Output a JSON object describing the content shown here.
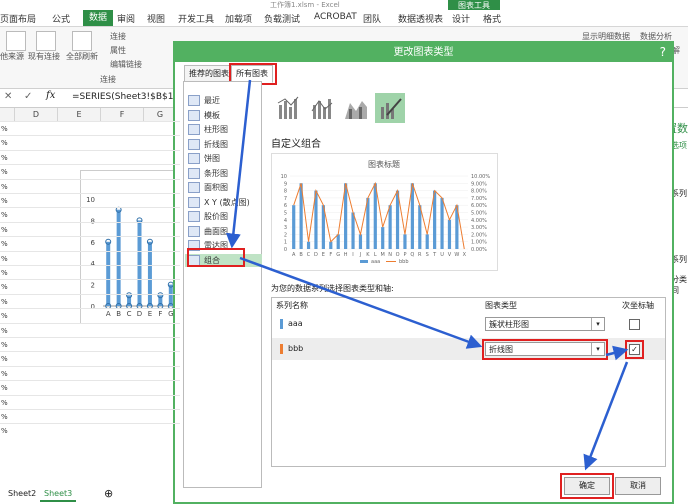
{
  "window": {
    "title": "工作簿1.xlsm - Excel",
    "tool_tab": "图表工具"
  },
  "tabs": [
    "页面布局",
    "公式",
    "数据",
    "审阅",
    "视图",
    "开发工具",
    "加载项",
    "负载测试",
    "ACROBAT",
    "团队",
    "数据透视表",
    "设计",
    "格式"
  ],
  "ribbon": {
    "btn1": "他来源",
    "btn2": "现有连接",
    "btn3": "全部刷新",
    "small1": "连接",
    "small2": "属性",
    "small3": "编辑链接",
    "group": "连接",
    "show_detail": "显示明细数据",
    "data_analysis": "数据分析",
    "solve": "解"
  },
  "formula": {
    "text": "=SERIES(Sheet3!$B$1,S"
  },
  "columns": [
    "D",
    "E",
    "F",
    "G"
  ],
  "row_marks": [
    "%",
    "%",
    "%",
    "%",
    "%",
    "%",
    "%",
    "%",
    "%",
    "%",
    "%",
    "%",
    "%",
    "%",
    "%",
    "%",
    "%",
    "%",
    "%",
    "%",
    "%",
    "%"
  ],
  "sheets": [
    "Sheet2",
    "Sheet3"
  ],
  "dialog": {
    "title": "更改图表类型",
    "close": "?",
    "tab_recommended": "推荐的图表",
    "tab_all": "所有图表",
    "chart_types": [
      "最近",
      "模板",
      "柱形图",
      "折线图",
      "饼图",
      "条形图",
      "面积图",
      "X Y (散点图)",
      "股价图",
      "曲面图",
      "雷达图",
      "组合"
    ],
    "section_title": "自定义组合",
    "preview_title": "图表标题",
    "series_prompt": "为您的数据系列选择图表类型和轴:",
    "col_series": "系列名称",
    "col_type": "图表类型",
    "col_axis": "次坐标轴",
    "series_rows": [
      {
        "name": "aaa",
        "type": "簇状柱形图",
        "color": "#5b9bd5",
        "secondary": ""
      },
      {
        "name": "bbb",
        "type": "折线图",
        "color": "#ed7d31",
        "secondary": "✓"
      }
    ],
    "ok": "确定",
    "cancel": "取消"
  },
  "right_pane": {
    "title": "设置数",
    "sub": "系列选项",
    "a": "系列",
    "b": "系列",
    "c": "分类间"
  },
  "chart_data": [
    {
      "type": "bar",
      "categories": [
        "A",
        "B",
        "C",
        "D",
        "E",
        "F",
        "G"
      ],
      "values": [
        6,
        9,
        1,
        8,
        6,
        1,
        2
      ],
      "ylim": [
        0,
        10
      ],
      "yticks": [
        "0",
        "2",
        "4",
        "6",
        "8",
        "10"
      ],
      "color": "#5b9bd5"
    },
    {
      "type": "bar-line",
      "title": "图表标题",
      "categories": [
        "A",
        "B",
        "C",
        "D",
        "E",
        "F",
        "G",
        "H",
        "I",
        "J",
        "K",
        "L",
        "M",
        "N",
        "O",
        "P",
        "Q",
        "R",
        "S",
        "T",
        "U",
        "V",
        "W",
        "X"
      ],
      "series": [
        {
          "name": "aaa",
          "values": [
            6,
            9,
            1,
            8,
            6,
            1,
            2,
            9,
            5,
            2,
            7,
            9,
            3,
            6,
            8,
            2,
            9,
            6,
            2,
            8,
            7,
            4,
            6,
            0
          ]
        },
        {
          "name": "bbb",
          "values": [
            0.06,
            0.09,
            0.01,
            0.08,
            0.06,
            0.01,
            0.02,
            0.09,
            0.05,
            0.02,
            0.07,
            0.09,
            0.03,
            0.06,
            0.08,
            0.02,
            0.09,
            0.06,
            0.02,
            0.08,
            0.07,
            0.04,
            0.06,
            0.0
          ]
        }
      ],
      "yticks_left": [
        "0",
        "1",
        "2",
        "3",
        "4",
        "5",
        "6",
        "7",
        "8",
        "9",
        "10"
      ],
      "yticks_right": [
        "0.00%",
        "1.00%",
        "2.00%",
        "3.00%",
        "4.00%",
        "5.00%",
        "6.00%",
        "7.00%",
        "8.00%",
        "9.00%",
        "10.00%"
      ],
      "ylim": [
        0,
        10
      ],
      "ylim2": [
        0,
        0.1
      ],
      "legend": [
        "aaa",
        "bbb"
      ]
    }
  ]
}
